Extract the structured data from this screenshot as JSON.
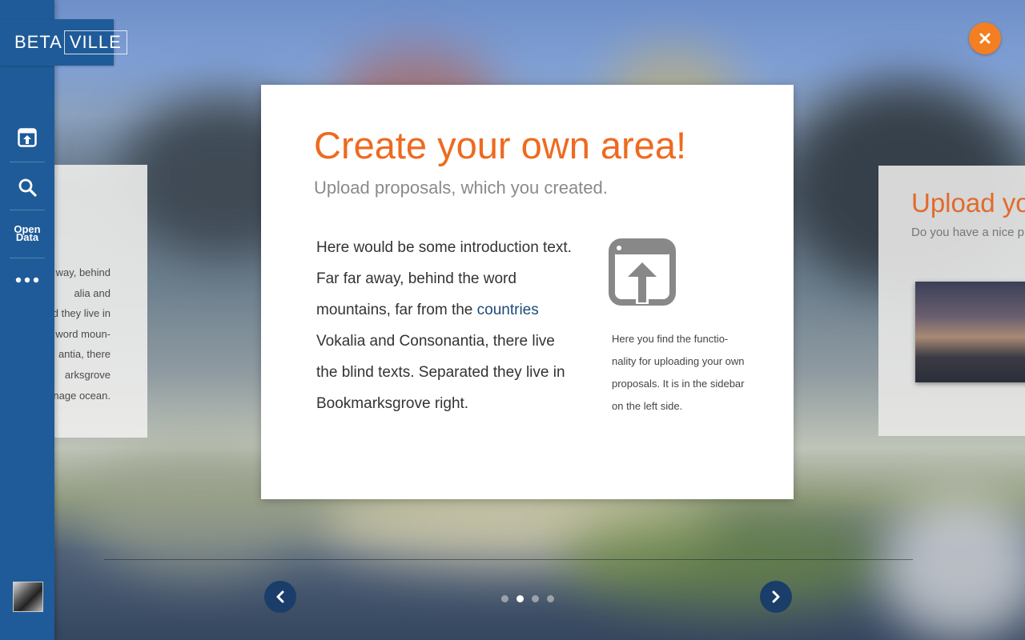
{
  "brand": {
    "part1": "BETA",
    "part2": "VILLE"
  },
  "sidebar": {
    "items": [
      {
        "name": "upload",
        "icon": "upload-icon"
      },
      {
        "name": "search",
        "icon": "search-icon"
      },
      {
        "name": "open-data",
        "label_line1": "Open",
        "label_line2": "Data"
      },
      {
        "name": "more",
        "icon": "more-dots-icon"
      }
    ]
  },
  "left_card": {
    "lines": [
      "way, behind",
      "alia and",
      "d they live in",
      "word moun-",
      "antia, there",
      "arksgrove",
      "nage ocean."
    ]
  },
  "main": {
    "title": "Create your own area!",
    "subtitle": "Upload proposals, which you created.",
    "body_before_link": "Here would be some introduction text. Far far away, behind the word mountains, far from the ",
    "body_link": "countries",
    "body_after_link": " Vokalia and Consonantia, there live the blind texts. Separated they live in Bookmarksgrove right.",
    "side_note": "Here you find the functio-nality for uploading your own proposals. It is in the sidebar on the left side."
  },
  "right_card": {
    "title": "Upload you",
    "subtitle": "Do you have a nice p"
  },
  "pagination": {
    "total": 4,
    "active_index": 1
  },
  "colors": {
    "sidebar": "#1f5b98",
    "accent_orange": "#ee6a1f",
    "close_button": "#f37f22",
    "nav_button": "#1a3d6a",
    "link": "#1d4a7a"
  }
}
